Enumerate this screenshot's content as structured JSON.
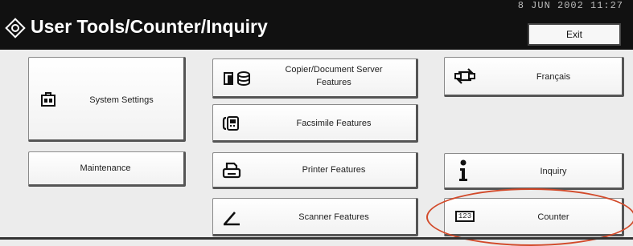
{
  "header": {
    "title": "User Tools/Counter/Inquiry",
    "datetime": "8 JUN  2002 11:27",
    "exit_label": "Exit"
  },
  "buttons": {
    "system_settings": {
      "label": "System Settings",
      "icon": "toolbox-icon"
    },
    "maintenance": {
      "label": "Maintenance"
    },
    "copier": {
      "label_line1": "Copier/Document Server",
      "label_line2": "Features",
      "icon": "copier-document-server-icon"
    },
    "facsimile": {
      "label": "Facsimile Features",
      "icon": "facsimile-icon"
    },
    "printer": {
      "label": "Printer Features",
      "icon": "printer-icon"
    },
    "scanner": {
      "label": "Scanner Features",
      "icon": "scanner-icon"
    },
    "language": {
      "label": "Français",
      "icon": "language-switch-icon"
    },
    "inquiry": {
      "label": "Inquiry",
      "icon": "info-icon"
    },
    "counter": {
      "label": "Counter",
      "icon": "counter-icon",
      "icon_text": "123"
    }
  },
  "annotation": {
    "color": "#d24a2a"
  }
}
